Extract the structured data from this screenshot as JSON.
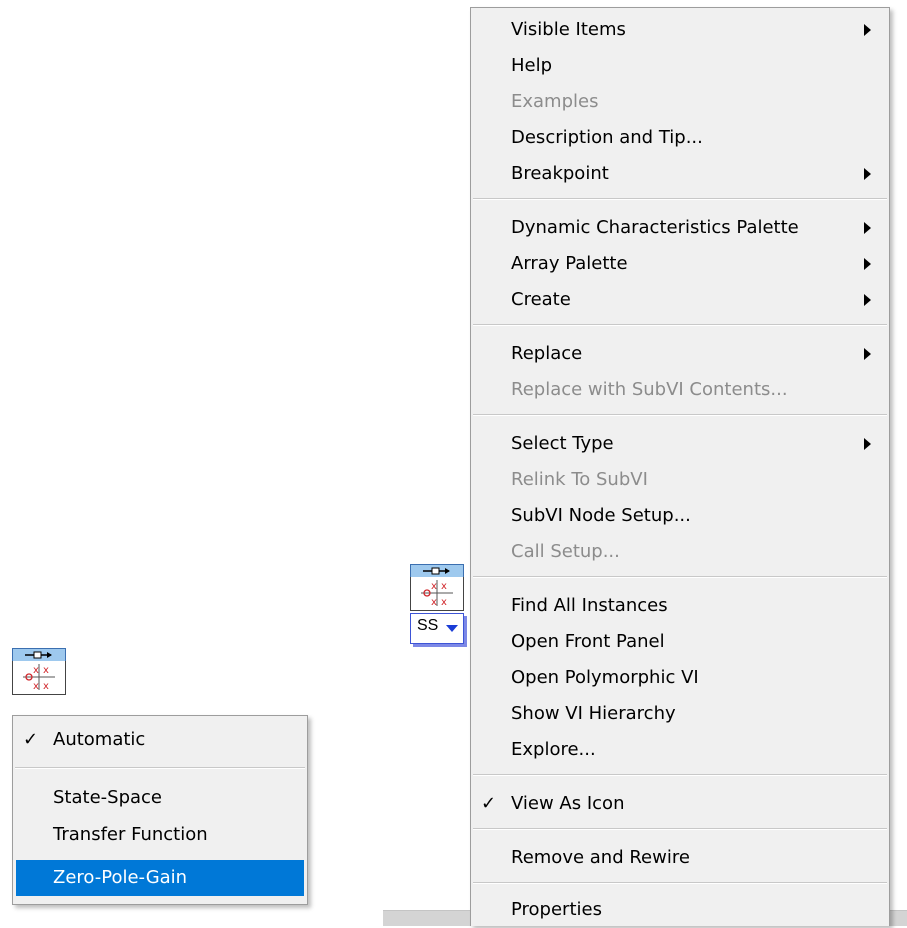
{
  "context_menu": {
    "items": [
      {
        "label": "Visible Items",
        "submenu": true
      },
      {
        "label": "Help"
      },
      {
        "label": "Examples",
        "disabled": true
      },
      {
        "label": "Description and Tip..."
      },
      {
        "label": "Breakpoint",
        "submenu": true
      },
      {
        "label": "Dynamic Characteristics Palette",
        "submenu": true
      },
      {
        "label": "Array Palette",
        "submenu": true
      },
      {
        "label": "Create",
        "submenu": true
      },
      {
        "label": "Replace",
        "submenu": true
      },
      {
        "label": "Replace with SubVI Contents...",
        "disabled": true
      },
      {
        "label": "Select Type",
        "submenu": true
      },
      {
        "label": "Relink To SubVI",
        "disabled": true
      },
      {
        "label": "SubVI Node Setup..."
      },
      {
        "label": "Call Setup...",
        "disabled": true
      },
      {
        "label": "Find All Instances"
      },
      {
        "label": "Open Front Panel"
      },
      {
        "label": "Open Polymorphic VI"
      },
      {
        "label": "Show VI Hierarchy"
      },
      {
        "label": "Explore..."
      },
      {
        "label": "View As Icon",
        "checked": true
      },
      {
        "label": "Remove and Rewire"
      },
      {
        "label": "Properties"
      }
    ]
  },
  "type_menu": {
    "items": [
      {
        "label": "Automatic",
        "checked": true
      },
      {
        "label": "State-Space"
      },
      {
        "label": "Transfer Function"
      },
      {
        "label": "Zero-Pole-Gain",
        "selected": true
      }
    ]
  },
  "selector": {
    "value": "SS"
  },
  "icons": {
    "vi_icon": "zero-pole-plot-icon",
    "check": "checkmark-icon",
    "arrow": "submenu-arrow-icon"
  },
  "colors": {
    "highlight": "#0078d7",
    "menu_bg": "#f0f0f0",
    "disabled_text": "#8c8c8c",
    "icon_header": "#9ec9ee",
    "selector_border": "#3d54d6"
  }
}
